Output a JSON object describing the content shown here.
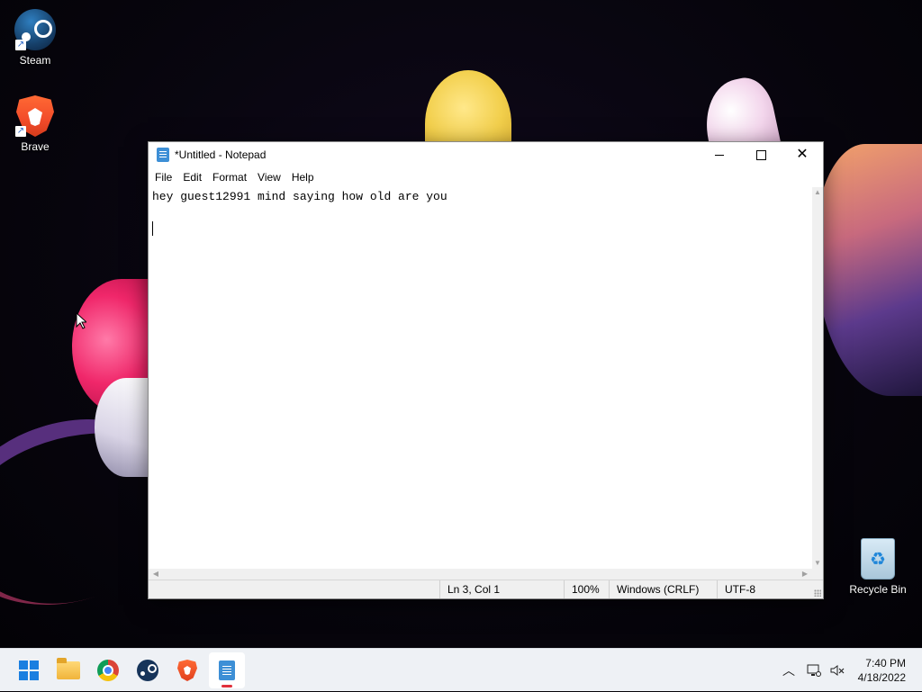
{
  "desktop": {
    "icons": [
      {
        "label": "Steam",
        "icon": "steam-icon"
      },
      {
        "label": "Brave",
        "icon": "brave-icon"
      },
      {
        "label": "Recycle Bin",
        "icon": "recycle-bin-icon"
      }
    ]
  },
  "window": {
    "title": "*Untitled - Notepad",
    "menu": [
      "File",
      "Edit",
      "Format",
      "View",
      "Help"
    ],
    "content": "hey guest12991 mind saying how old are you",
    "status": {
      "position": "Ln 3, Col 1",
      "zoom": "100%",
      "line_ending": "Windows (CRLF)",
      "encoding": "UTF-8"
    }
  },
  "taskbar": {
    "apps": [
      "start-icon",
      "file-explorer-icon",
      "chrome-icon",
      "steam-icon",
      "brave-icon",
      "notepad-icon"
    ],
    "active_app": "notepad-icon",
    "clock": {
      "time": "7:40 PM",
      "date": "4/18/2022"
    }
  },
  "colors": {
    "taskbar_bg": "#eef1f5",
    "active_indicator": "#e0303c",
    "window_bg": "#ffffff",
    "statusbar_bg": "#f0f0f0"
  }
}
